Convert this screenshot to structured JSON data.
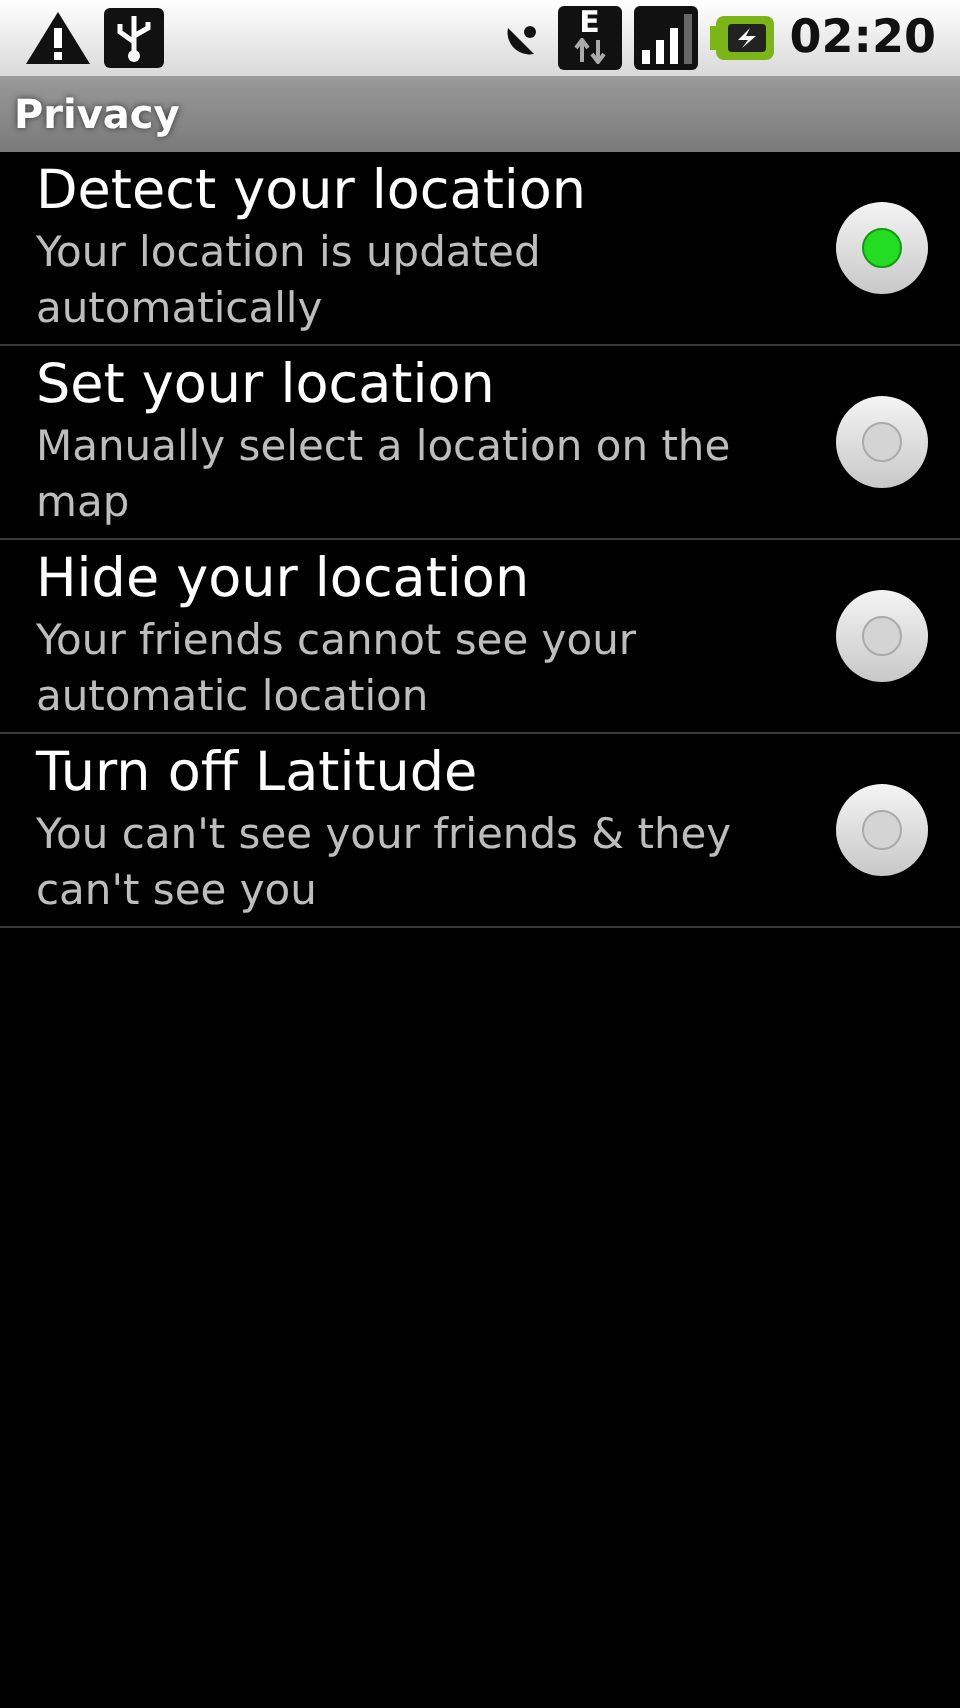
{
  "status_bar": {
    "network_type": "E",
    "time": "02:20"
  },
  "title": "Privacy",
  "options": [
    {
      "title": "Detect your location",
      "summary": "Your location is updated automatically",
      "selected": true
    },
    {
      "title": "Set your location",
      "summary": "Manually select a location on the map",
      "selected": false
    },
    {
      "title": "Hide your location",
      "summary": "Your friends cannot see your automatic location",
      "selected": false
    },
    {
      "title": "Turn off Latitude",
      "summary": "You can't see your friends & they can't see you",
      "selected": false
    }
  ]
}
